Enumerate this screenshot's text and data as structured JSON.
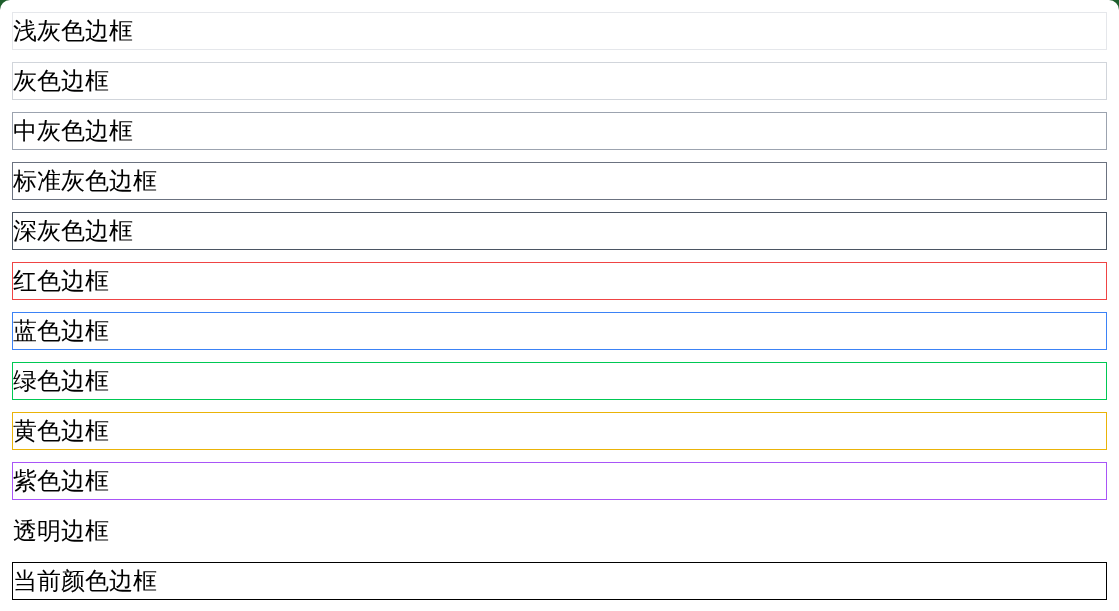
{
  "boxes": [
    {
      "label": "浅灰色边框",
      "kind": "solid",
      "color": "#e5e7eb"
    },
    {
      "label": "灰色边框",
      "kind": "solid",
      "color": "#d1d5db"
    },
    {
      "label": "中灰色边框",
      "kind": "solid",
      "color": "#9ca3af"
    },
    {
      "label": "标准灰色边框",
      "kind": "solid",
      "color": "#6b7280"
    },
    {
      "label": "深灰色边框",
      "kind": "solid",
      "color": "#4b5563"
    },
    {
      "label": "红色边框",
      "kind": "solid",
      "color": "#ef4444"
    },
    {
      "label": "蓝色边框",
      "kind": "solid",
      "color": "#3b82f6"
    },
    {
      "label": "绿色边框",
      "kind": "solid",
      "color": "#00c853"
    },
    {
      "label": "黄色边框",
      "kind": "solid",
      "color": "#eab308"
    },
    {
      "label": "紫色边框",
      "kind": "solid",
      "color": "#a855f7"
    },
    {
      "label": "透明边框",
      "kind": "none"
    },
    {
      "label": "当前颜色边框",
      "kind": "solid",
      "color": "#000000"
    }
  ]
}
